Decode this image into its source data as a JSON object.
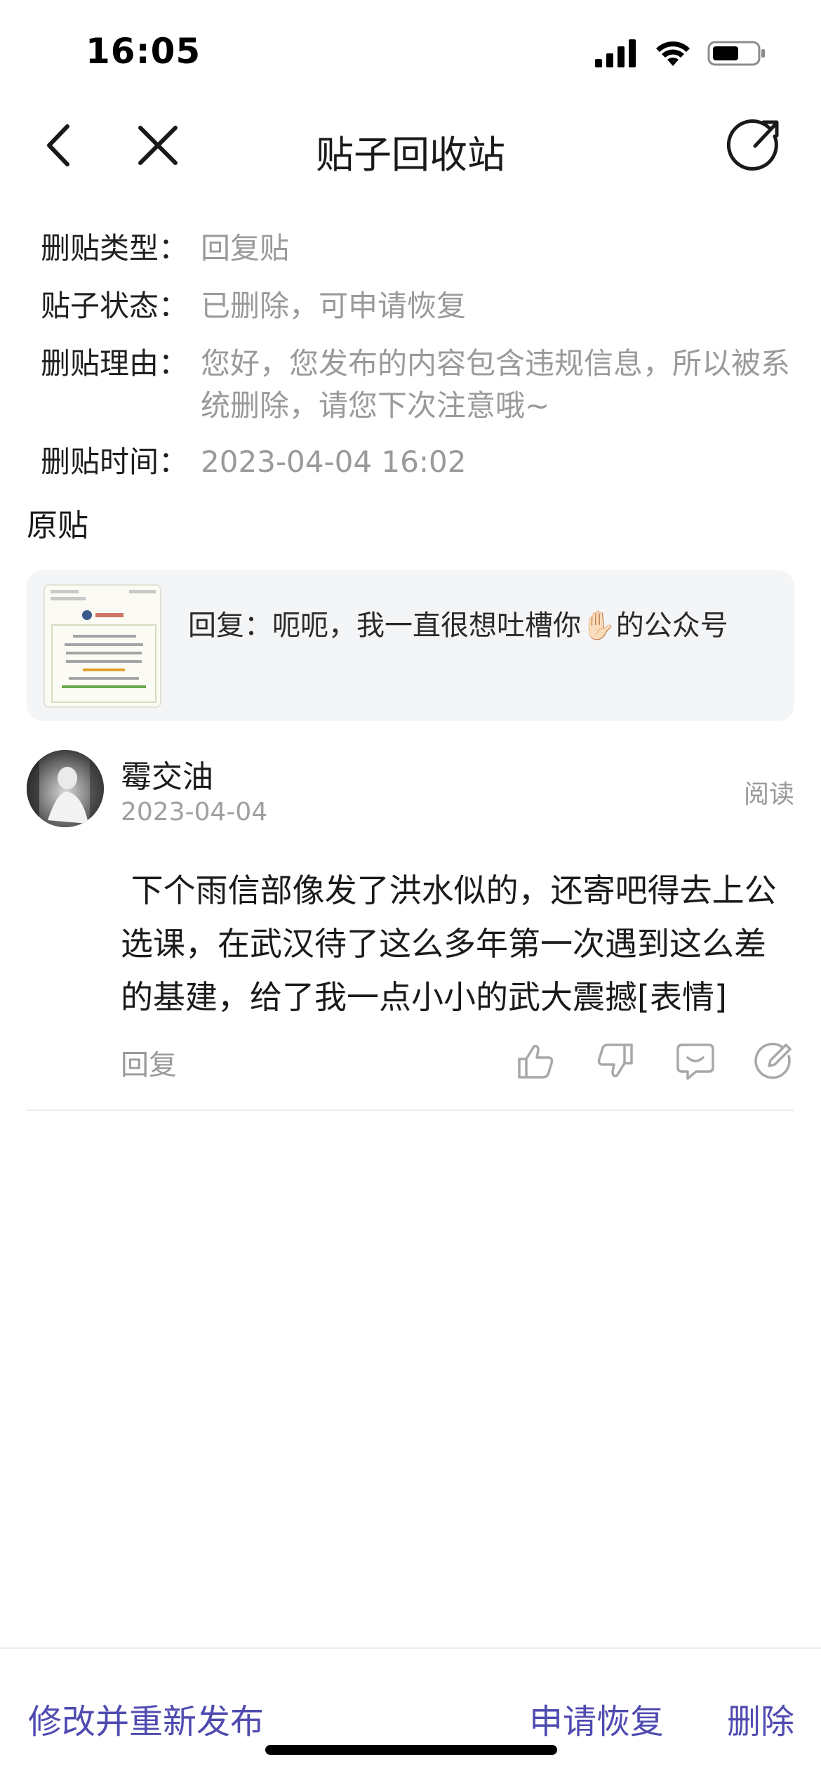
{
  "status_bar": {
    "time": "16:05",
    "icons": [
      "signal-icon",
      "wifi-icon",
      "battery-icon"
    ]
  },
  "nav": {
    "title": "贴子回收站",
    "icons": [
      "back-icon",
      "close-icon",
      "share-icon"
    ]
  },
  "info": {
    "type_label": "删贴类型：",
    "type_value": "回复贴",
    "status_label": "贴子状态：",
    "status_value": "已删除，可申请恢复",
    "reason_label": "删贴理由：",
    "reason_value": "您好，您发布的内容包含违规信息，所以被系统删除，请您下次注意哦~",
    "time_label": "删贴时间：",
    "time_value": "2023-04-04 16:02"
  },
  "original": {
    "section_title": "原贴",
    "quote_text": "回复：呃呃，我一直很想吐槽你✋🏻的公众号"
  },
  "comment": {
    "username": "霉交油",
    "date": "2023-04-04",
    "read_label": "阅读",
    "body": " 下个雨信部像发了洪水似的，还寄吧得去上公选课，在武汉待了这么多年第一次遇到这么差的基建，给了我一点小小的武大震撼[表情]",
    "reply_label": "回复",
    "action_icons": [
      "thumbs-up-icon",
      "thumbs-down-icon",
      "comment-icon",
      "edit-icon"
    ]
  },
  "bottom": {
    "edit_republish": "修改并重新发布",
    "request_restore": "申请恢复",
    "delete": "删除"
  },
  "colors": {
    "accent": "#4f4bb0",
    "muted_text": "#9a9a9a",
    "card_bg": "#f4f5f7"
  }
}
